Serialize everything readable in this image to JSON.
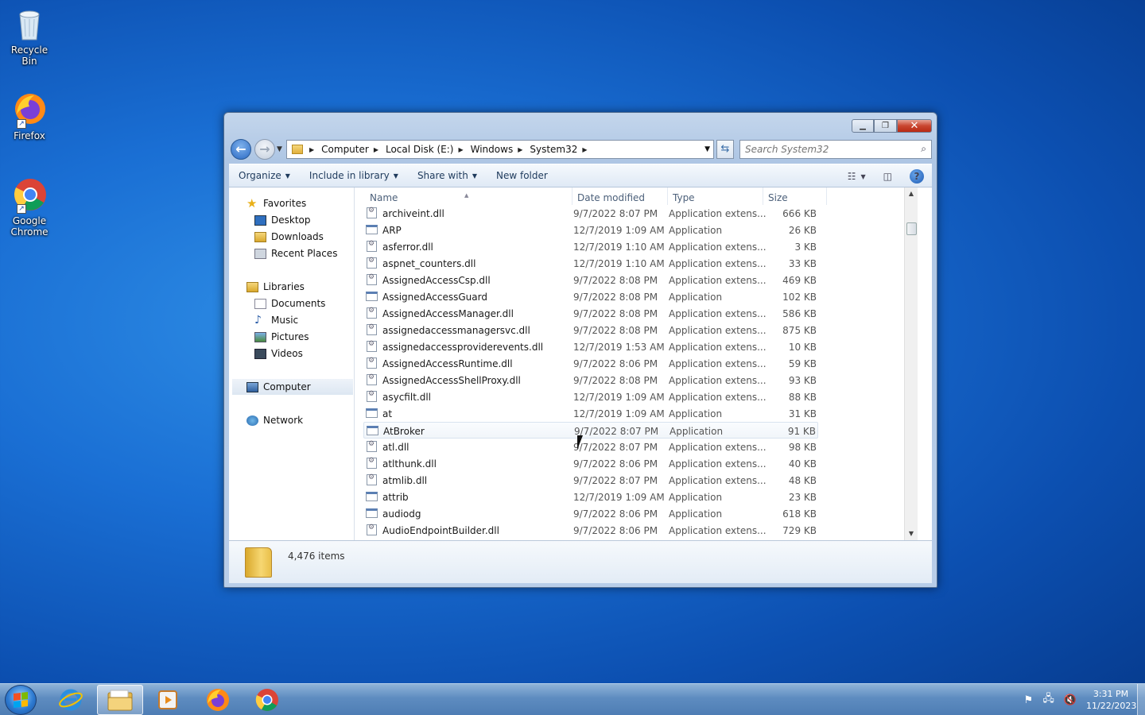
{
  "desktop": {
    "icons": [
      {
        "label": "Recycle Bin",
        "icon": "recycle-bin-icon"
      },
      {
        "label": "Firefox",
        "icon": "firefox-icon"
      },
      {
        "label": "Google Chrome",
        "icon": "chrome-icon"
      }
    ]
  },
  "window": {
    "address": {
      "segments": [
        "Computer",
        "Local Disk (E:)",
        "Windows",
        "System32"
      ]
    },
    "search": {
      "placeholder": "Search System32"
    },
    "toolbar": {
      "organize": "Organize",
      "include_in_library": "Include in library",
      "share_with": "Share with",
      "new_folder": "New folder"
    },
    "nav_pane": {
      "favorites": "Favorites",
      "desktop": "Desktop",
      "downloads": "Downloads",
      "recent_places": "Recent Places",
      "libraries": "Libraries",
      "documents": "Documents",
      "music": "Music",
      "pictures": "Pictures",
      "videos": "Videos",
      "computer": "Computer",
      "network": "Network"
    },
    "columns": {
      "name": "Name",
      "date_modified": "Date modified",
      "type": "Type",
      "size": "Size"
    },
    "files": [
      {
        "name": "archiveint.dll",
        "date": "9/7/2022 8:07 PM",
        "type": "Application extens...",
        "size": "666 KB",
        "kind": "dll"
      },
      {
        "name": "ARP",
        "date": "12/7/2019 1:09 AM",
        "type": "Application",
        "size": "26 KB",
        "kind": "app"
      },
      {
        "name": "asferror.dll",
        "date": "12/7/2019 1:10 AM",
        "type": "Application extens...",
        "size": "3 KB",
        "kind": "dll"
      },
      {
        "name": "aspnet_counters.dll",
        "date": "12/7/2019 1:10 AM",
        "type": "Application extens...",
        "size": "33 KB",
        "kind": "dll"
      },
      {
        "name": "AssignedAccessCsp.dll",
        "date": "9/7/2022 8:08 PM",
        "type": "Application extens...",
        "size": "469 KB",
        "kind": "dll"
      },
      {
        "name": "AssignedAccessGuard",
        "date": "9/7/2022 8:08 PM",
        "type": "Application",
        "size": "102 KB",
        "kind": "app"
      },
      {
        "name": "AssignedAccessManager.dll",
        "date": "9/7/2022 8:08 PM",
        "type": "Application extens...",
        "size": "586 KB",
        "kind": "dll"
      },
      {
        "name": "assignedaccessmanagersvc.dll",
        "date": "9/7/2022 8:08 PM",
        "type": "Application extens...",
        "size": "875 KB",
        "kind": "dll"
      },
      {
        "name": "assignedaccessproviderevents.dll",
        "date": "12/7/2019 1:53 AM",
        "type": "Application extens...",
        "size": "10 KB",
        "kind": "dll"
      },
      {
        "name": "AssignedAccessRuntime.dll",
        "date": "9/7/2022 8:06 PM",
        "type": "Application extens...",
        "size": "59 KB",
        "kind": "dll"
      },
      {
        "name": "AssignedAccessShellProxy.dll",
        "date": "9/7/2022 8:08 PM",
        "type": "Application extens...",
        "size": "93 KB",
        "kind": "dll"
      },
      {
        "name": "asycfilt.dll",
        "date": "12/7/2019 1:09 AM",
        "type": "Application extens...",
        "size": "88 KB",
        "kind": "dll"
      },
      {
        "name": "at",
        "date": "12/7/2019 1:09 AM",
        "type": "Application",
        "size": "31 KB",
        "kind": "app"
      },
      {
        "name": "AtBroker",
        "date": "9/7/2022 8:07 PM",
        "type": "Application",
        "size": "91 KB",
        "kind": "app"
      },
      {
        "name": "atl.dll",
        "date": "9/7/2022 8:07 PM",
        "type": "Application extens...",
        "size": "98 KB",
        "kind": "dll"
      },
      {
        "name": "atlthunk.dll",
        "date": "9/7/2022 8:06 PM",
        "type": "Application extens...",
        "size": "40 KB",
        "kind": "dll"
      },
      {
        "name": "atmlib.dll",
        "date": "9/7/2022 8:07 PM",
        "type": "Application extens...",
        "size": "48 KB",
        "kind": "dll"
      },
      {
        "name": "attrib",
        "date": "12/7/2019 1:09 AM",
        "type": "Application",
        "size": "23 KB",
        "kind": "app"
      },
      {
        "name": "audiodg",
        "date": "9/7/2022 8:06 PM",
        "type": "Application",
        "size": "618 KB",
        "kind": "app"
      },
      {
        "name": "AudioEndpointBuilder.dll",
        "date": "9/7/2022 8:06 PM",
        "type": "Application extens...",
        "size": "729 KB",
        "kind": "dll"
      }
    ],
    "hover_index": 13,
    "status": {
      "item_count": "4,476 items"
    }
  },
  "taskbar": {
    "clock_time": "3:31 PM",
    "clock_date": "11/22/2023"
  }
}
